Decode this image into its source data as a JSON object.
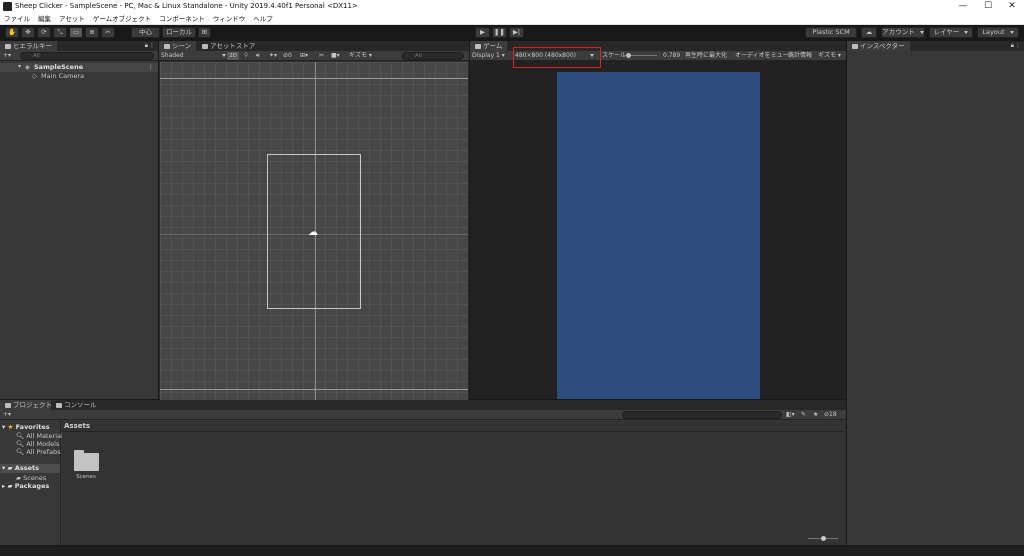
{
  "window": {
    "title": "Sheep Clicker - SampleScene - PC, Mac & Linux Standalone - Unity 2019.4.40f1 Personal <DX11>",
    "minimize": "—",
    "maximize": "☐",
    "close": "✕"
  },
  "menu": [
    "ファイル",
    "編集",
    "アセット",
    "ゲームオブジェクト",
    "コンポーネント",
    "ウィンドウ",
    "ヘルプ"
  ],
  "toolbar": {
    "pivot_label": "中心",
    "space_label": "ローカル",
    "plastic_label": "Plastic SCM",
    "account_label": "アカウント",
    "layers_label": "レイヤー",
    "layout_label": "Layout"
  },
  "hierarchy": {
    "tab_label": "ヒエラルキー",
    "search_placeholder": "All",
    "scene_name": "SampleScene",
    "items": [
      "Main Camera"
    ]
  },
  "scene": {
    "tab_label": "シーン",
    "asset_store_tab": "アセットストア",
    "shading_mode": "Shaded",
    "mode_2d": "2D",
    "layers_count": "0",
    "gizmos_label": "ギズモ",
    "search_placeholder": "All"
  },
  "game": {
    "tab_label": "ゲーム",
    "display_label": "Display 1",
    "resolution_label": "480×800 (480x800)",
    "scale_label": "スケール",
    "scale_value": "0.789",
    "maximize_on_play": "再生時に最大化",
    "mute_audio": "オーディオをミュート",
    "stats": "統計情報",
    "gizmos_label": "ギズモ",
    "camera_background": "#2e4d7e",
    "highlight_color": "#e02020"
  },
  "inspector": {
    "tab_label": "インスペクター"
  },
  "project": {
    "tab_label": "プロジェクト",
    "console_tab": "コンソール",
    "breadcrumb": "Assets",
    "favorites_label": "Favorites",
    "favorites": [
      "All Materials",
      "All Models",
      "All Prefabs"
    ],
    "assets_label": "Assets",
    "assets_children": [
      "Scenes"
    ],
    "packages_label": "Packages",
    "grid_items": [
      "Scenes"
    ],
    "hidden_count": "18"
  }
}
